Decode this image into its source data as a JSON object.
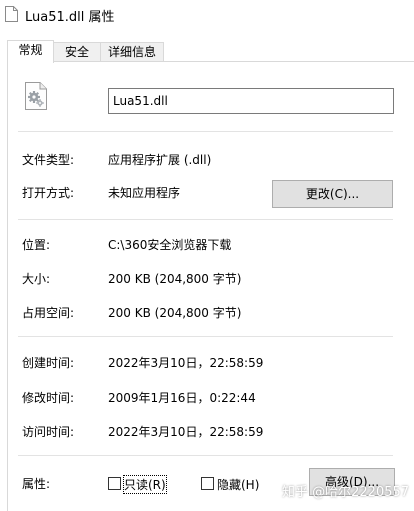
{
  "window": {
    "title": "Lua51.dll 属性"
  },
  "tabs": [
    {
      "label": "常规",
      "active": true
    },
    {
      "label": "安全",
      "active": false
    },
    {
      "label": "详细信息",
      "active": false
    }
  ],
  "file": {
    "icon": "dll-gear-file-icon",
    "name": "Lua51.dll"
  },
  "fields": {
    "type": {
      "label": "文件类型:",
      "value": "应用程序扩展 (.dll)"
    },
    "opens_with": {
      "label": "打开方式:",
      "value": "未知应用程序",
      "button": "更改(C)..."
    },
    "location": {
      "label": "位置:",
      "value": "C:\\360安全浏览器下载"
    },
    "size": {
      "label": "大小:",
      "value": "200 KB (204,800 字节)"
    },
    "size_on_disk": {
      "label": "占用空间:",
      "value": "200 KB (204,800 字节)"
    },
    "created": {
      "label": "创建时间:",
      "value": "2022年3月10日，22:58:59"
    },
    "modified": {
      "label": "修改时间:",
      "value": "2009年1月16日，0:22:44"
    },
    "accessed": {
      "label": "访问时间:",
      "value": "2022年3月10日，22:58:59"
    }
  },
  "attributes": {
    "label": "属性:",
    "readonly": {
      "label": "只读(R)",
      "checked": false
    },
    "hidden": {
      "label": "隐藏(H)",
      "checked": false
    },
    "advanced_button": "高级(D)..."
  },
  "watermark": "知乎 @哈尔2220557"
}
